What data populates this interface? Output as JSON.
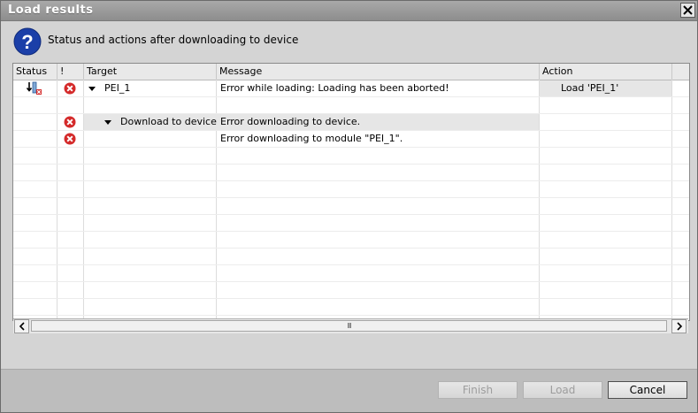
{
  "window": {
    "title": "Load results"
  },
  "header": {
    "text": "Status and actions after downloading to device"
  },
  "grid": {
    "columns": [
      "Status",
      "!",
      "Target",
      "Message",
      "Action"
    ],
    "rows": [
      {
        "status_icon": "download-error-icon",
        "error": true,
        "target": "PEI_1",
        "expanded": true,
        "message": "Error while loading: Loading has been aborted!",
        "action": "Load 'PEI_1'"
      },
      {
        "status_icon": "",
        "error": false,
        "target": "",
        "message": "",
        "action": ""
      },
      {
        "status_icon": "",
        "error": true,
        "target": "Download to device",
        "expanded": true,
        "message": "Error downloading to device.",
        "action": ""
      },
      {
        "status_icon": "",
        "error": true,
        "target": "",
        "message": "Error downloading to module \"PEI_1\".",
        "action": ""
      }
    ]
  },
  "scrollbar": {
    "grip": "III"
  },
  "buttons": {
    "finish": "Finish",
    "load": "Load",
    "cancel": "Cancel"
  },
  "colors": {
    "error_red": "#d42a2a",
    "help_blue": "#1b3fa8",
    "selected_row": "#e6e6e6"
  }
}
